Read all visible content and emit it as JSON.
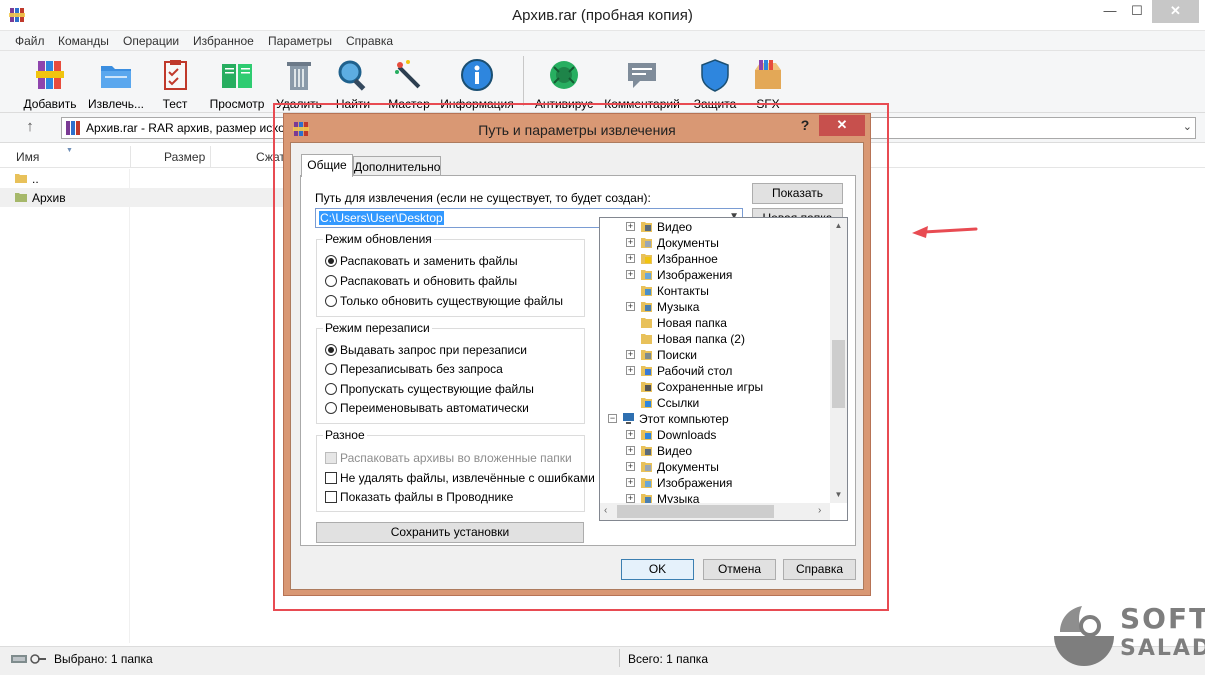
{
  "window": {
    "title": "Архив.rar (пробная копия)",
    "controls": {
      "minimize": "—",
      "maximize": "☐",
      "close": "✕"
    }
  },
  "menu": [
    "Файл",
    "Команды",
    "Операции",
    "Избранное",
    "Параметры",
    "Справка"
  ],
  "toolbar": [
    {
      "label": "Добавить",
      "icon": "books-icon"
    },
    {
      "label": "Извлечь...",
      "icon": "folder-extract-icon"
    },
    {
      "label": "Тест",
      "icon": "clipboard-check-icon"
    },
    {
      "label": "Просмотр",
      "icon": "book-icon"
    },
    {
      "label": "Удалить",
      "icon": "trash-icon"
    },
    {
      "label": "Найти",
      "icon": "magnifier-icon"
    },
    {
      "label": "Мастер",
      "icon": "magic-wand-icon"
    },
    {
      "label": "Информация",
      "icon": "info-icon"
    },
    {
      "label": "Антивирус",
      "icon": "bug-icon"
    },
    {
      "label": "Комментарий",
      "icon": "speech-bubble-icon"
    },
    {
      "label": "Защита",
      "icon": "shield-icon"
    },
    {
      "label": "SFX",
      "icon": "box-icon"
    }
  ],
  "address": {
    "up_icon": "↑",
    "text": "Архив.rar - RAR архив, размер исходн",
    "drop": "⌄"
  },
  "columns": [
    "Имя",
    "Размер",
    "Сжат"
  ],
  "files": [
    {
      "name": ".."
    },
    {
      "name": "Архив"
    }
  ],
  "status": {
    "selected": "Выбрано: 1 папка",
    "total": "Всего: 1 папка"
  },
  "dialog": {
    "title": "Путь и параметры извлечения",
    "help": "?",
    "close": "✕",
    "tabs": [
      "Общие",
      "Дополнительно"
    ],
    "path_label": "Путь для извлечения (если не существует, то будет создан):",
    "path_value": "C:\\Users\\User\\Desktop",
    "show_button": "Показать",
    "new_folder_button": "Новая папка",
    "update_mode": {
      "title": "Режим обновления",
      "options": [
        "Распаковать и заменить файлы",
        "Распаковать и обновить файлы",
        "Только обновить существующие файлы"
      ],
      "selected": 0
    },
    "overwrite_mode": {
      "title": "Режим перезаписи",
      "options": [
        "Выдавать запрос при перезаписи",
        "Перезаписывать без запроса",
        "Пропускать существующие файлы",
        "Переименовывать автоматически"
      ],
      "selected": 0
    },
    "misc": {
      "title": "Разное",
      "options": [
        {
          "label": "Распаковать архивы во вложенные папки",
          "checked": false,
          "disabled": true
        },
        {
          "label": "Не удалять файлы, извлечённые с ошибками",
          "checked": false,
          "disabled": false
        },
        {
          "label": "Показать файлы в Проводнике",
          "checked": false,
          "disabled": false
        }
      ]
    },
    "save_button": "Сохранить установки",
    "tree": [
      {
        "label": "Видео",
        "icon": "video-folder-icon",
        "level": 1,
        "expander": "+"
      },
      {
        "label": "Документы",
        "icon": "documents-folder-icon",
        "level": 1,
        "expander": "+"
      },
      {
        "label": "Избранное",
        "icon": "star-folder-icon",
        "level": 1,
        "expander": "+"
      },
      {
        "label": "Изображения",
        "icon": "pictures-folder-icon",
        "level": 1,
        "expander": "+"
      },
      {
        "label": "Контакты",
        "icon": "contacts-folder-icon",
        "level": 1,
        "expander": ""
      },
      {
        "label": "Музыка",
        "icon": "music-folder-icon",
        "level": 1,
        "expander": "+"
      },
      {
        "label": "Новая папка",
        "icon": "folder-icon",
        "level": 1,
        "expander": ""
      },
      {
        "label": "Новая папка (2)",
        "icon": "folder-icon",
        "level": 1,
        "expander": ""
      },
      {
        "label": "Поиски",
        "icon": "search-folder-icon",
        "level": 1,
        "expander": "+"
      },
      {
        "label": "Рабочий стол",
        "icon": "desktop-folder-icon",
        "level": 1,
        "expander": "+"
      },
      {
        "label": "Сохраненные игры",
        "icon": "games-folder-icon",
        "level": 1,
        "expander": ""
      },
      {
        "label": "Ссылки",
        "icon": "links-folder-icon",
        "level": 1,
        "expander": ""
      },
      {
        "label": "Этот компьютер",
        "icon": "computer-icon",
        "level": 0,
        "expander": "−"
      },
      {
        "label": "Downloads",
        "icon": "downloads-folder-icon",
        "level": 1,
        "expander": "+"
      },
      {
        "label": "Видео",
        "icon": "video-folder-icon",
        "level": 1,
        "expander": "+"
      },
      {
        "label": "Документы",
        "icon": "documents-folder-icon",
        "level": 1,
        "expander": "+"
      },
      {
        "label": "Изображения",
        "icon": "pictures-folder-icon",
        "level": 1,
        "expander": "+"
      },
      {
        "label": "Музыка",
        "icon": "music-folder-icon",
        "level": 1,
        "expander": "+"
      }
    ],
    "ok_button": "OK",
    "cancel_button": "Отмена",
    "help_button": "Справка"
  },
  "watermark": {
    "line1": "SOFT",
    "line2": "SALAD"
  },
  "colors": {
    "highlight_frame": "#e84b52",
    "dialog_frame": "#d99874",
    "selection": "#3399ff"
  }
}
